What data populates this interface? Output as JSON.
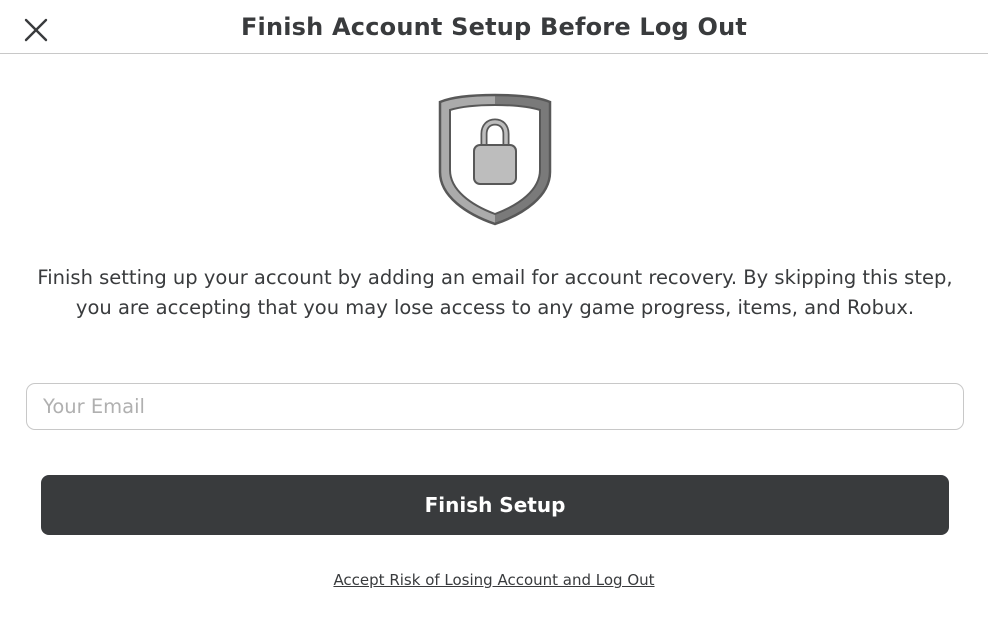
{
  "dialog": {
    "title": "Finish Account Setup Before Log Out",
    "close_icon": "close-icon",
    "shield_icon": "shield-lock-icon",
    "message": "Finish setting up your account by adding an email for account recovery. By skipping this step, you are accepting that you may lose access to any game progress, items, and Robux.",
    "email": {
      "placeholder": "Your Email",
      "value": ""
    },
    "finish_button_label": "Finish Setup",
    "accept_risk_link": "Accept Risk of Losing Account and Log Out"
  },
  "colors": {
    "text": "#393b3d",
    "button_bg": "#393b3d",
    "button_text": "#ffffff",
    "border": "#c8c8c8",
    "placeholder": "#b0b0b0"
  }
}
